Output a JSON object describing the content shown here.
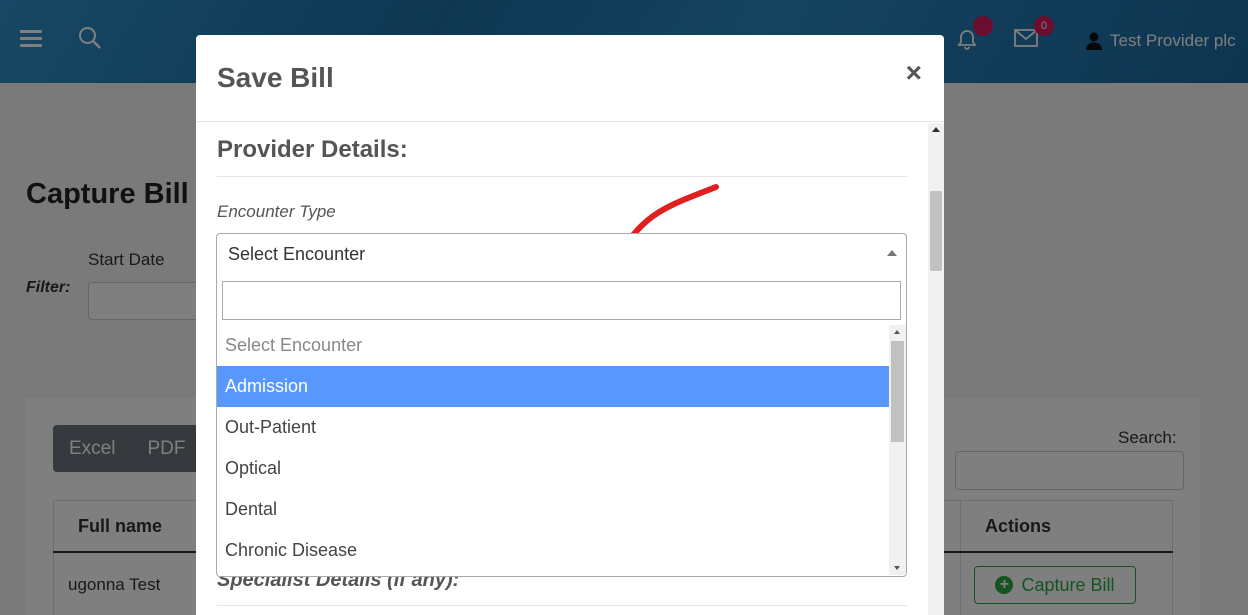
{
  "header": {
    "user_name": "Test Provider plc",
    "notification_badge": "",
    "mail_badge": "0",
    "icons": [
      "menu-icon",
      "search-icon",
      "bell-icon",
      "envelope-icon",
      "user-icon"
    ]
  },
  "page": {
    "title": "Capture Bill",
    "filter_label": "Filter:",
    "start_date_label": "Start Date",
    "export_buttons": [
      "Excel",
      "PDF"
    ],
    "search_label": "Search:",
    "table": {
      "headers": [
        "Full name",
        "Actions"
      ],
      "rows": [
        {
          "full_name": "ugonna Test",
          "action_label": "Capture Bill"
        }
      ]
    }
  },
  "modal": {
    "title": "Save Bill",
    "close_symbol": "×",
    "section_title": "Provider Details:",
    "encounter_label": "Encounter Type",
    "encounter_selected": "Select Encounter",
    "encounter_options": [
      "Select Encounter",
      "Admission",
      "Out-Patient",
      "Optical",
      "Dental",
      "Chronic Disease"
    ],
    "highlighted_option": "Admission",
    "specialist_title": "Specialist Details (if any):"
  },
  "colors": {
    "header_bg": "#2a86c0",
    "highlight": "#5897fb",
    "badge": "#d81b60",
    "success": "#28a745",
    "annotation_arrow": "#e02020"
  }
}
